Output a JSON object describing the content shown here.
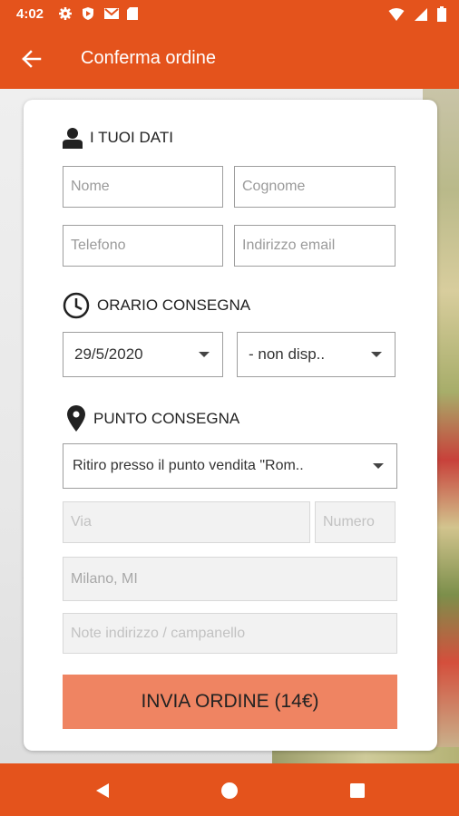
{
  "status_bar": {
    "time": "4:02"
  },
  "app_bar": {
    "title": "Conferma ordine"
  },
  "personal_section": {
    "title": "I TUOI DATI",
    "name_placeholder": "Nome",
    "surname_placeholder": "Cognome",
    "phone_placeholder": "Telefono",
    "email_placeholder": "Indirizzo email"
  },
  "delivery_time_section": {
    "title": "ORARIO CONSEGNA",
    "date_value": "29/5/2020",
    "time_value": "- non disp.."
  },
  "delivery_point_section": {
    "title": "PUNTO CONSEGNA",
    "point_value": "Ritiro presso il punto vendita \"Rom..",
    "street_placeholder": "Via",
    "number_placeholder": "Numero",
    "city_value": "Milano, MI",
    "notes_placeholder": "Note indirizzo / campanello"
  },
  "submit_label": "INVIA ORDINE (14€)",
  "colors": {
    "primary": "#e4531c",
    "button": "#ef8462"
  }
}
